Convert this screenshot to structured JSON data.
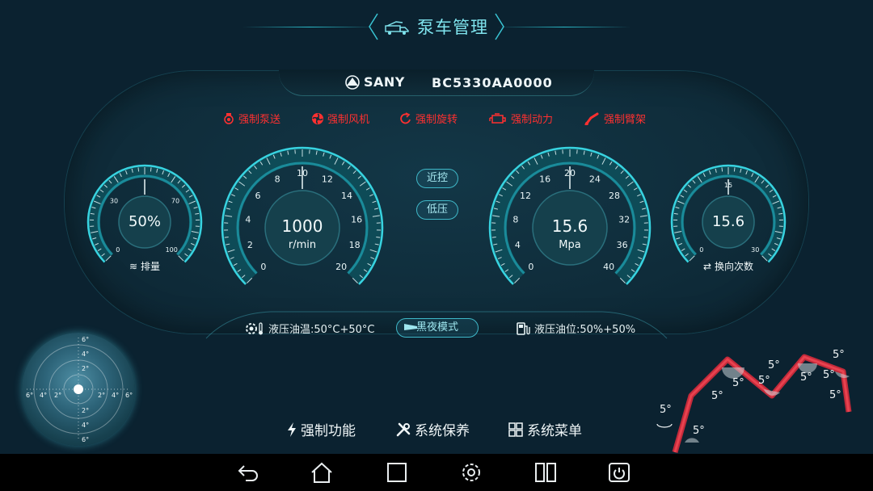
{
  "header": {
    "title": "泵车管理"
  },
  "vehicle": {
    "brand": "SANY",
    "model": "BC5330AA0000"
  },
  "force_functions": [
    {
      "label": "强制泵送",
      "icon": "pump-icon"
    },
    {
      "label": "强制风机",
      "icon": "fan-icon"
    },
    {
      "label": "强制旋转",
      "icon": "rotate-icon"
    },
    {
      "label": "强制动力",
      "icon": "engine-icon"
    },
    {
      "label": "强制臂架",
      "icon": "boom-icon"
    }
  ],
  "buttons": {
    "near_control": "近控",
    "low_pressure": "低压",
    "night_mode": "黑夜模式"
  },
  "gauges": {
    "displacement": {
      "value_text": "50%",
      "value": 50,
      "min": 0,
      "max": 100,
      "ticks": [
        "0",
        "30",
        "70",
        "100"
      ],
      "label": "排量"
    },
    "rpm": {
      "value_text": "1000",
      "unit": "r/min",
      "value": 1000,
      "ticks": [
        "0",
        "2",
        "4",
        "6",
        "8",
        "10",
        "12",
        "14",
        "16",
        "18",
        "20"
      ]
    },
    "pressure": {
      "value_text": "15.6",
      "unit": "Mpa",
      "value": 15.6,
      "ticks": [
        "0",
        "4",
        "8",
        "12",
        "16",
        "20",
        "24",
        "28",
        "32",
        "36",
        "40"
      ]
    },
    "switch_count": {
      "value_text": "15.6",
      "value": 15.6,
      "ticks": [
        "0",
        "15",
        "30"
      ],
      "label": "换向次数"
    }
  },
  "status": {
    "oil_temp": "液压油温:50°C+50°C",
    "oil_level": "液压油位:50%+50%"
  },
  "level_indicator": {
    "v_labels": [
      "6°",
      "4°",
      "2°",
      "2°",
      "4°",
      "6°"
    ],
    "h_labels": [
      "6°",
      "4°",
      "2°",
      "2°",
      "4°",
      "6°"
    ]
  },
  "boom_angles": [
    "5°",
    "5°",
    "5°",
    "5°",
    "5°",
    "5°",
    "5°",
    "5°",
    "5°",
    "5°"
  ],
  "bottom_menu": [
    {
      "label": "强制功能",
      "icon": "lightning-icon"
    },
    {
      "label": "系统保养",
      "icon": "wrench-icon"
    },
    {
      "label": "系统菜单",
      "icon": "grid-icon"
    }
  ],
  "nav": [
    "back-icon",
    "home-icon",
    "recent-icon",
    "settings-icon",
    "split-icon",
    "power-icon"
  ],
  "colors": {
    "accent": "#2fc8d6",
    "alert": "#ff3030",
    "bg": "#0b2230"
  }
}
